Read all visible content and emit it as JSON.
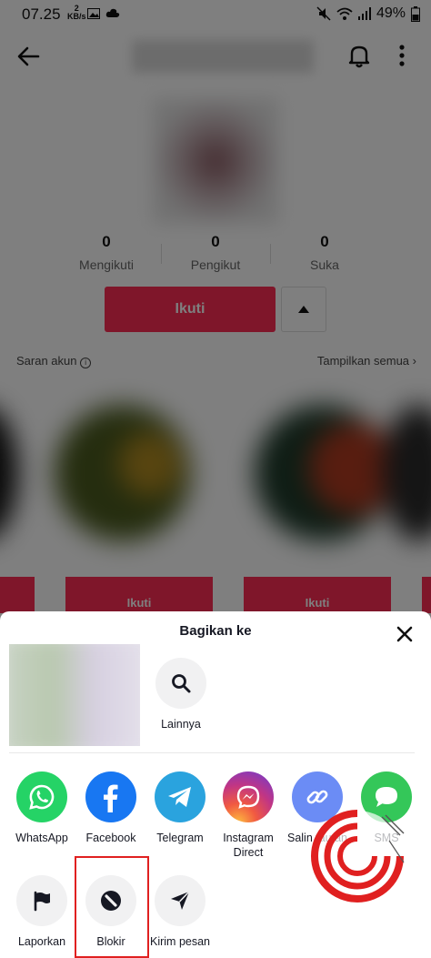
{
  "status": {
    "time": "07.25",
    "net_speed_value": "2",
    "net_speed_unit": "KB/s",
    "battery": "49%"
  },
  "profile": {
    "stats": [
      {
        "value": "0",
        "label": "Mengikuti"
      },
      {
        "value": "0",
        "label": "Pengikut"
      },
      {
        "value": "0",
        "label": "Suka"
      }
    ],
    "follow_label": "Ikuti",
    "suggested_label": "Saran akun",
    "show_all_label": "Tampilkan semua",
    "card_button_label": "Ikuti"
  },
  "share_sheet": {
    "title": "Bagikan ke",
    "more_label": "Lainnya",
    "apps": [
      {
        "label": "WhatsApp",
        "icon": "whatsapp-icon",
        "color": "#25d366"
      },
      {
        "label": "Facebook",
        "icon": "facebook-icon",
        "color": "#1877f2"
      },
      {
        "label": "Telegram",
        "icon": "telegram-icon",
        "color": "#2aa3de"
      },
      {
        "label": "Instagram Direct",
        "icon": "instagram-direct-icon",
        "color": "#c13584"
      },
      {
        "label": "Salin tautan",
        "icon": "link-icon",
        "color": "#6b8cf5"
      },
      {
        "label": "SMS",
        "icon": "sms-icon",
        "color": "#34c759"
      }
    ],
    "actions": [
      {
        "label": "Laporkan",
        "icon": "flag-icon"
      },
      {
        "label": "Blokir",
        "icon": "block-icon"
      },
      {
        "label": "Kirim pesan",
        "icon": "send-icon"
      }
    ]
  },
  "colors": {
    "accent": "#fe2c55",
    "highlight": "#e02020"
  }
}
